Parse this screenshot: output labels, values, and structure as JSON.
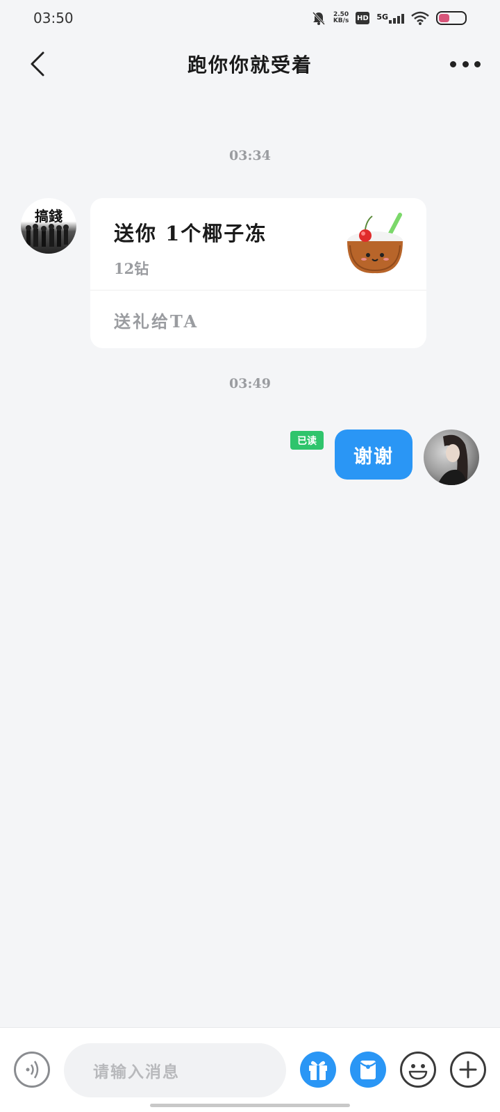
{
  "status_bar": {
    "time": "03:50",
    "net_speed_value": "2.50",
    "net_speed_unit": "KB/s",
    "hd_label": "HD",
    "signal_label": "5G"
  },
  "header": {
    "title": "跑你你就受着"
  },
  "messages": {
    "timestamp_1": "03:34",
    "gift_card": {
      "title": "送你 1个椰子冻",
      "price": "12钻",
      "action_label": "送礼给TA"
    },
    "avatar_left_text": "搞錢",
    "timestamp_2": "03:49",
    "read_status": "已读",
    "my_message": "谢谢"
  },
  "input_bar": {
    "placeholder": "请输入消息"
  },
  "colors": {
    "accent": "#2a96f5",
    "read_badge": "#2fc46c",
    "background": "#f4f5f7"
  }
}
